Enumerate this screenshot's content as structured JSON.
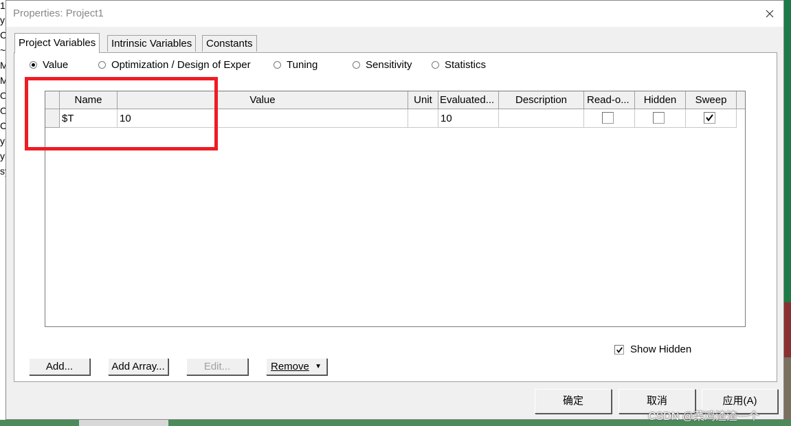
{
  "background": {
    "left_chars": [
      "1",
      "yl",
      "Cr",
      "~",
      "M",
      "M",
      "Ol",
      "Ol",
      "Cl",
      "yl",
      "yl",
      "sy"
    ]
  },
  "dialog": {
    "title": "Properties: Project1",
    "close_glyph": "×"
  },
  "tabs": [
    {
      "label": "Project Variables",
      "active": true
    },
    {
      "label": "Intrinsic Variables",
      "active": false
    },
    {
      "label": "Constants",
      "active": false
    }
  ],
  "modes": [
    {
      "label": "Value",
      "checked": true
    },
    {
      "label": "Optimization / Design of Exper",
      "checked": false
    },
    {
      "label": "Tuning",
      "checked": false
    },
    {
      "label": "Sensitivity",
      "checked": false
    },
    {
      "label": "Statistics",
      "checked": false
    }
  ],
  "table": {
    "columns": [
      "Name",
      "Value",
      "Unit",
      "Evaluated...",
      "Description",
      "Read-o...",
      "Hidden",
      "Sweep"
    ],
    "rows": [
      {
        "name": "$T",
        "value": "10",
        "unit": "",
        "evaluated": "10",
        "description": "",
        "read_only": false,
        "hidden": false,
        "sweep": true
      }
    ]
  },
  "show_hidden": {
    "label": "Show Hidden",
    "checked": true
  },
  "buttons": {
    "add": "Add...",
    "add_array": "Add Array...",
    "edit": "Edit...",
    "remove": "Remove",
    "ok": "确定",
    "cancel": "取消",
    "apply": "应用(A)"
  },
  "watermark": "CSDN @菜鸡渣渣一个",
  "colors": {
    "highlight": "#ee1c24",
    "dialog_bg": "#f0f0f0"
  }
}
